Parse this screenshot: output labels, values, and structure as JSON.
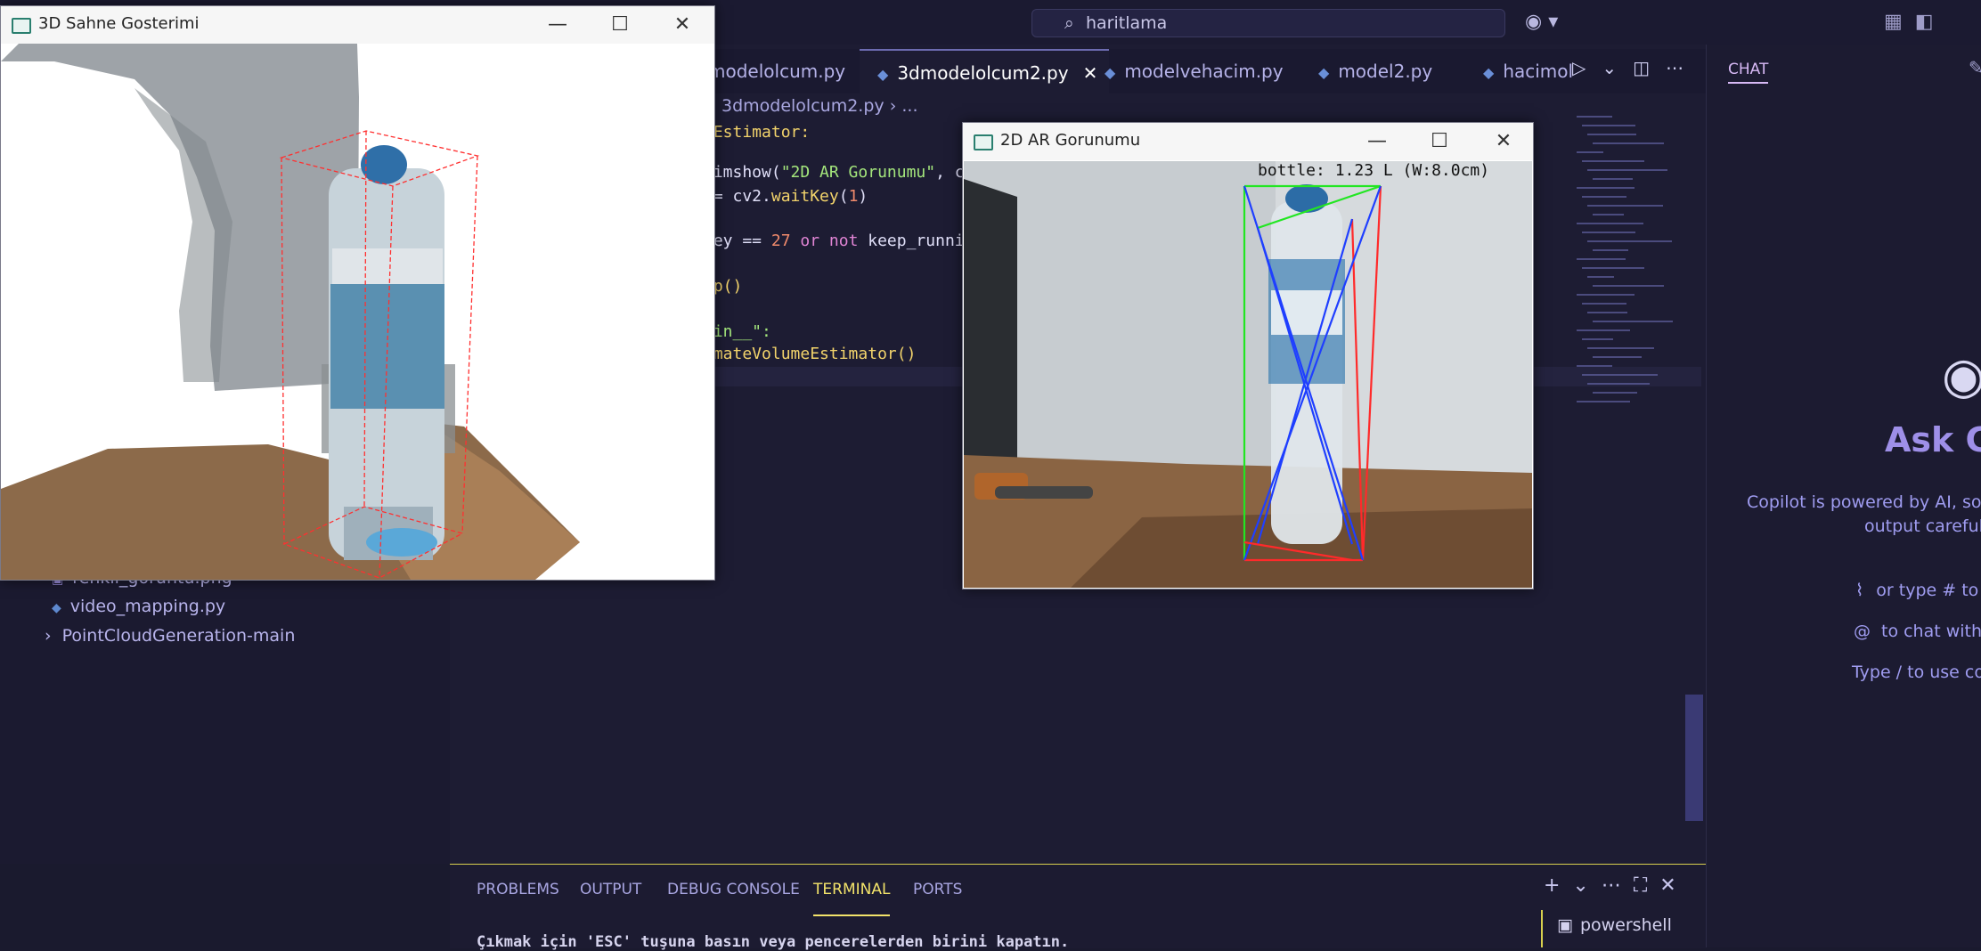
{
  "titlebar": {
    "search_text": "haritlama",
    "search_icon": "search-icon",
    "copilot_icon": "copilot-icon"
  },
  "editor": {
    "tabs": [
      {
        "label": "modelolcum.py",
        "active": false
      },
      {
        "label": "3dmodelolcum2.py",
        "active": true
      },
      {
        "label": "modelvehacim.py",
        "active": false
      },
      {
        "label": "model2.py",
        "active": false
      },
      {
        "label": "hacimol",
        "active": false
      }
    ],
    "breadcrumb_file": "3dmodelolcum2.py",
    "breadcrumb_more": "...",
    "code": {
      "line1": "eEstimator:",
      "line2_a": ".imshow(",
      "line2_b": "\"2D AR Gorunumu\"",
      "line2_c": ", c",
      "line3_a": " = cv2.",
      "line3_b": "waitKey",
      "line3_c": "(",
      "line3_d": "1",
      "line3_e": ")",
      "line4_a": "key == ",
      "line4_b": "27",
      "line4_c": " or not ",
      "line4_d": "keep_runni",
      "line5": "op()",
      "line6": "ain__\":",
      "line7": "imateVolumeEstimator()"
    }
  },
  "explorer": {
    "items": [
      {
        "label": "renkli_goruntu.png",
        "icon": "image-file-icon"
      },
      {
        "label": "video_mapping.py",
        "icon": "python-file-icon"
      },
      {
        "label": "PointCloudGeneration-main",
        "icon": "chevron-right-icon"
      }
    ]
  },
  "chat": {
    "tab_label": "CHAT",
    "title": "Ask Co",
    "note_line1": "Copilot is powered by AI, so m",
    "note_line2": "output carefully",
    "hint1": "or type # to a",
    "hint2": "to chat with e",
    "hint3": "Type / to use con"
  },
  "panel": {
    "tabs": [
      "PROBLEMS",
      "OUTPUT",
      "DEBUG CONSOLE",
      "TERMINAL",
      "PORTS"
    ],
    "active_tab": "TERMINAL",
    "terminal_line": "Çıkmak için 'ESC' tuşuna basın veya pencerelerden birini kapatın.",
    "shell_label": "powershell"
  },
  "window3d": {
    "title": "3D Sahne Gosterimi"
  },
  "window2d": {
    "title": "2D AR Gorunumu",
    "ar_label": "bottle: 1.23 L (W:8.0cm)"
  },
  "colors": {
    "accent": "#f3e36a",
    "bbox_red": "#ff2a2a",
    "bbox_blue": "#1f3fff",
    "bbox_green": "#22e622"
  }
}
